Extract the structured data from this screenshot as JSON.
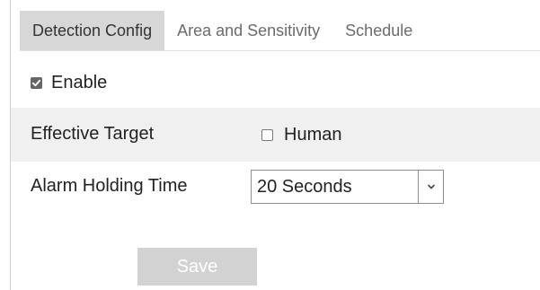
{
  "tabs": [
    {
      "label": "Detection Config",
      "active": true
    },
    {
      "label": "Area and Sensitivity",
      "active": false
    },
    {
      "label": "Schedule",
      "active": false
    }
  ],
  "enable": {
    "label": "Enable",
    "checked": true
  },
  "effective_target": {
    "label": "Effective Target",
    "human": {
      "label": "Human",
      "checked": false
    }
  },
  "alarm_holding_time": {
    "label": "Alarm Holding Time",
    "value": "20 Seconds"
  },
  "save_label": "Save",
  "colors": {
    "active_tab_bg": "#d7d7d7",
    "row_bg": "#f0f0f0",
    "button_bg": "#d2d2d2"
  }
}
